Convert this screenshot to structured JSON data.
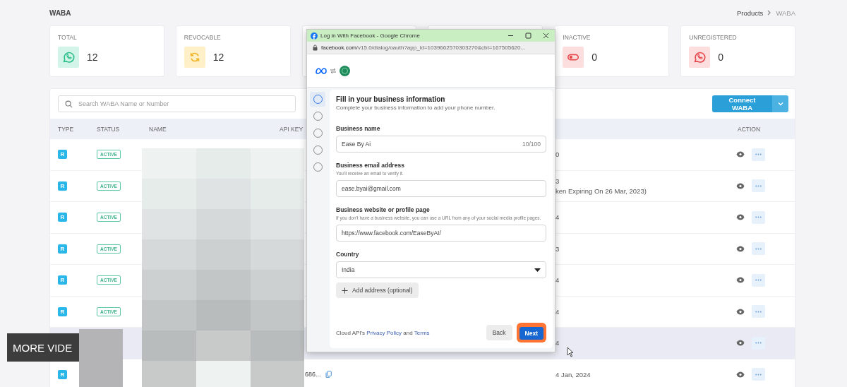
{
  "page": {
    "title": "WABA",
    "breadcrumb": [
      {
        "label": "Products",
        "current": false
      },
      {
        "label": "WABA",
        "current": true
      }
    ]
  },
  "stats": [
    {
      "label": "TOTAL",
      "value": "12",
      "kind": "total"
    },
    {
      "label": "REVOCABLE",
      "value": "12",
      "kind": "revocable"
    },
    {
      "label": "INACTIVE",
      "value": "0",
      "kind": "inactive"
    },
    {
      "label": "UNREGISTERED",
      "value": "0",
      "kind": "unregistered"
    }
  ],
  "toolbar": {
    "search_placeholder": "Search WABA Name or Number",
    "connect_button": "Connect WABA"
  },
  "table": {
    "columns": [
      "TYPE",
      "STATUS",
      "NAME",
      "API KEY",
      "ACTION"
    ],
    "rows": [
      {
        "type": "R",
        "status": "ACTIVE",
        "date": [
          "0"
        ],
        "hovered": false
      },
      {
        "type": "R",
        "status": "ACTIVE",
        "date": [
          "3",
          "ken Expiring On 26 Mar, 2023)"
        ],
        "hovered": false
      },
      {
        "type": "R",
        "status": "ACTIVE",
        "date": [
          "4"
        ],
        "hovered": false
      },
      {
        "type": "R",
        "status": "ACTIVE",
        "date": [
          "3"
        ],
        "hovered": false
      },
      {
        "type": "R",
        "status": "ACTIVE",
        "date": [
          "4"
        ],
        "hovered": false
      },
      {
        "type": "R",
        "status": "ACTIVE",
        "date": [
          "4"
        ],
        "hovered": false
      },
      {
        "date": [
          "4"
        ],
        "hovered": true
      },
      {
        "type": "R",
        "api_key": "686...",
        "date": [
          "4 Jan, 2024"
        ],
        "hovered": false
      }
    ]
  },
  "popup": {
    "title": "Log in With Facebook - Google Chrome",
    "url_host": "facebook.com",
    "url_path": "/v15.0/dialog/oauth?app_id=1039662570303270&cbt=167505620...",
    "steps": [
      {
        "selected": true
      },
      {
        "selected": false
      },
      {
        "selected": false
      },
      {
        "selected": false
      },
      {
        "selected": false
      }
    ],
    "heading": "Fill in your business information",
    "subheading": "Complete your business information to add your phone number.",
    "fields": [
      {
        "kind": "text",
        "label": "Business name",
        "value": "Ease By Ai",
        "counter": "10/100"
      },
      {
        "kind": "text",
        "label": "Business email address",
        "hint": "You'll receive an email to verify it.",
        "value": "ease.byai@gmail.com"
      },
      {
        "kind": "text",
        "label": "Business website or profile page",
        "hint": "If you don't have a business website, you can use a URL from any of your social media profile pages.",
        "value": "https://www.facebook.com/EaseByAI/"
      },
      {
        "kind": "select",
        "label": "Country",
        "value": "India"
      }
    ],
    "add_address": "Add address (optional)",
    "footer_prefix": "Cloud API's",
    "footer_link1": "Privacy Policy",
    "footer_and": "and",
    "footer_link2": "Terms",
    "back_button": "Back",
    "next_button": "Next",
    "next_highlighted": true
  },
  "video_overlay": {
    "label": "MORE VIDE"
  }
}
